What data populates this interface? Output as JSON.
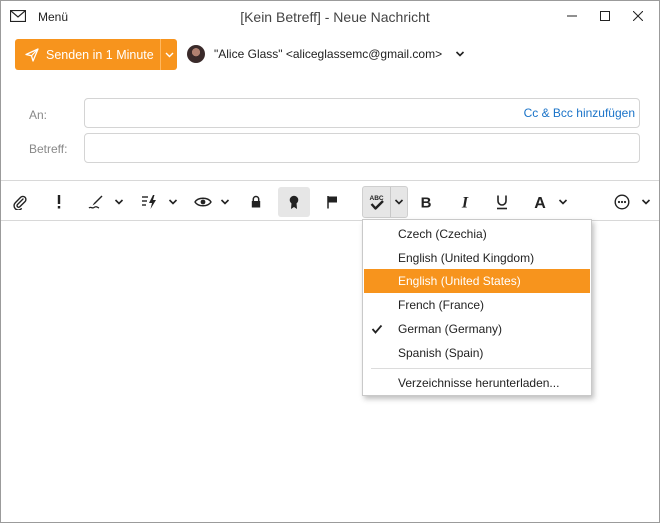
{
  "window": {
    "menu_label": "Menü",
    "title": "[Kein Betreff] - Neue Nachricht"
  },
  "send": {
    "label": "Senden in 1 Minute",
    "color": "#f7941d"
  },
  "sender": {
    "display": "\"Alice Glass\" <aliceglassemc@gmail.com>"
  },
  "fields": {
    "to_label": "An:",
    "to_value": "",
    "cc_bcc_link": "Cc & Bcc hinzufügen",
    "subject_label": "Betreff:",
    "subject_value": ""
  },
  "toolbar": {
    "icons": [
      "attach-icon",
      "priority-icon",
      "signature-icon",
      "template-icon",
      "read-receipt-icon",
      "encrypt-icon",
      "certificate-icon",
      "flag-icon",
      "spellcheck-icon",
      "bold-icon",
      "italic-icon",
      "underline-icon",
      "font-color-icon",
      "more-icon"
    ]
  },
  "spell_menu": {
    "items": [
      {
        "label": "Czech (Czechia)",
        "checked": false,
        "highlighted": false
      },
      {
        "label": "English (United Kingdom)",
        "checked": false,
        "highlighted": false
      },
      {
        "label": "English (United States)",
        "checked": false,
        "highlighted": true
      },
      {
        "label": "French (France)",
        "checked": false,
        "highlighted": false
      },
      {
        "label": "German (Germany)",
        "checked": true,
        "highlighted": false
      },
      {
        "label": "Spanish (Spain)",
        "checked": false,
        "highlighted": false
      }
    ],
    "download_label": "Verzeichnisse herunterladen...",
    "highlight_color": "#f7941d"
  }
}
